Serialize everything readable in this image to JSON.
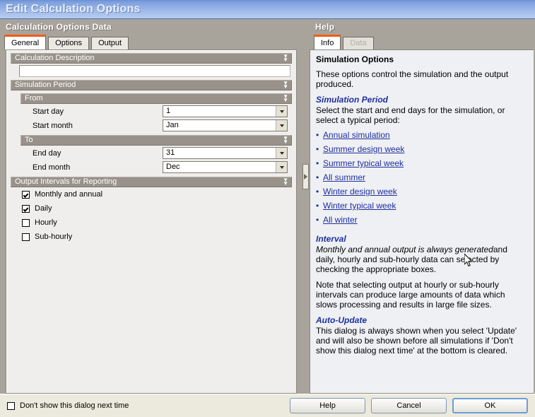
{
  "window": {
    "title": "Edit Calculation Options"
  },
  "left_panel": {
    "title": "Calculation Options Data",
    "tabs": [
      {
        "label": "General",
        "active": true
      },
      {
        "label": "Options",
        "active": false
      },
      {
        "label": "Output",
        "active": false
      }
    ],
    "sections": {
      "description": {
        "header": "Calculation Description",
        "value": "",
        "placeholder": ""
      },
      "simulation_period": {
        "header": "Simulation Period",
        "from": {
          "header": "From",
          "fields": [
            {
              "label": "Start day",
              "value": "1"
            },
            {
              "label": "Start month",
              "value": "Jan"
            }
          ]
        },
        "to": {
          "header": "To",
          "fields": [
            {
              "label": "End day",
              "value": "31"
            },
            {
              "label": "End month",
              "value": "Dec"
            }
          ]
        }
      },
      "output_intervals": {
        "header": "Output Intervals for Reporting",
        "checkboxes": [
          {
            "label": "Monthly and annual",
            "checked": true
          },
          {
            "label": "Daily",
            "checked": true
          },
          {
            "label": "Hourly",
            "checked": false
          },
          {
            "label": "Sub-hourly",
            "checked": false
          }
        ]
      }
    }
  },
  "right_panel": {
    "title": "Help",
    "tabs": [
      {
        "label": "Info",
        "active": true,
        "disabled": false
      },
      {
        "label": "Data",
        "active": false,
        "disabled": true
      }
    ],
    "content": {
      "heading": "Simulation Options",
      "intro": "These options control the simulation and the output produced.",
      "sim_period_heading": "Simulation Period",
      "sim_period_lead": "Select the start and end days for the simulation, or select a typical period:",
      "links": [
        "Annual simulation",
        "Summer design week",
        "Summer typical week",
        "All summer",
        "Winter design week",
        "Winter typical week",
        "All winter"
      ],
      "interval_heading": "Interval",
      "interval_italic": "Monthly and annual output is always generated",
      "interval_rest": "and daily, hourly and sub-hourly data can selected by checking the appropriate boxes.",
      "interval_note": "Note that selecting output at hourly or sub-hourly intervals can produce large amounts of data which slows processing and results in large file sizes.",
      "autoupdate_heading": "Auto-Update",
      "autoupdate_text": "This dialog is always shown when you select 'Update' and will also be shown before all simulations if 'Don't show this dialog next time' at the bottom is cleared."
    }
  },
  "footer": {
    "dont_show_label": "Don't show this dialog next time",
    "dont_show_checked": false,
    "buttons": [
      {
        "label": "Help",
        "default": false
      },
      {
        "label": "Cancel",
        "default": false
      },
      {
        "label": "OK",
        "default": true
      }
    ]
  },
  "colors": {
    "titlebar_blue": "#7fa0dc",
    "active_tab_accent": "#f25c17",
    "section_header": "#98928a",
    "help_link": "#1f2f9e",
    "default_button_border": "#6a9fd8"
  }
}
